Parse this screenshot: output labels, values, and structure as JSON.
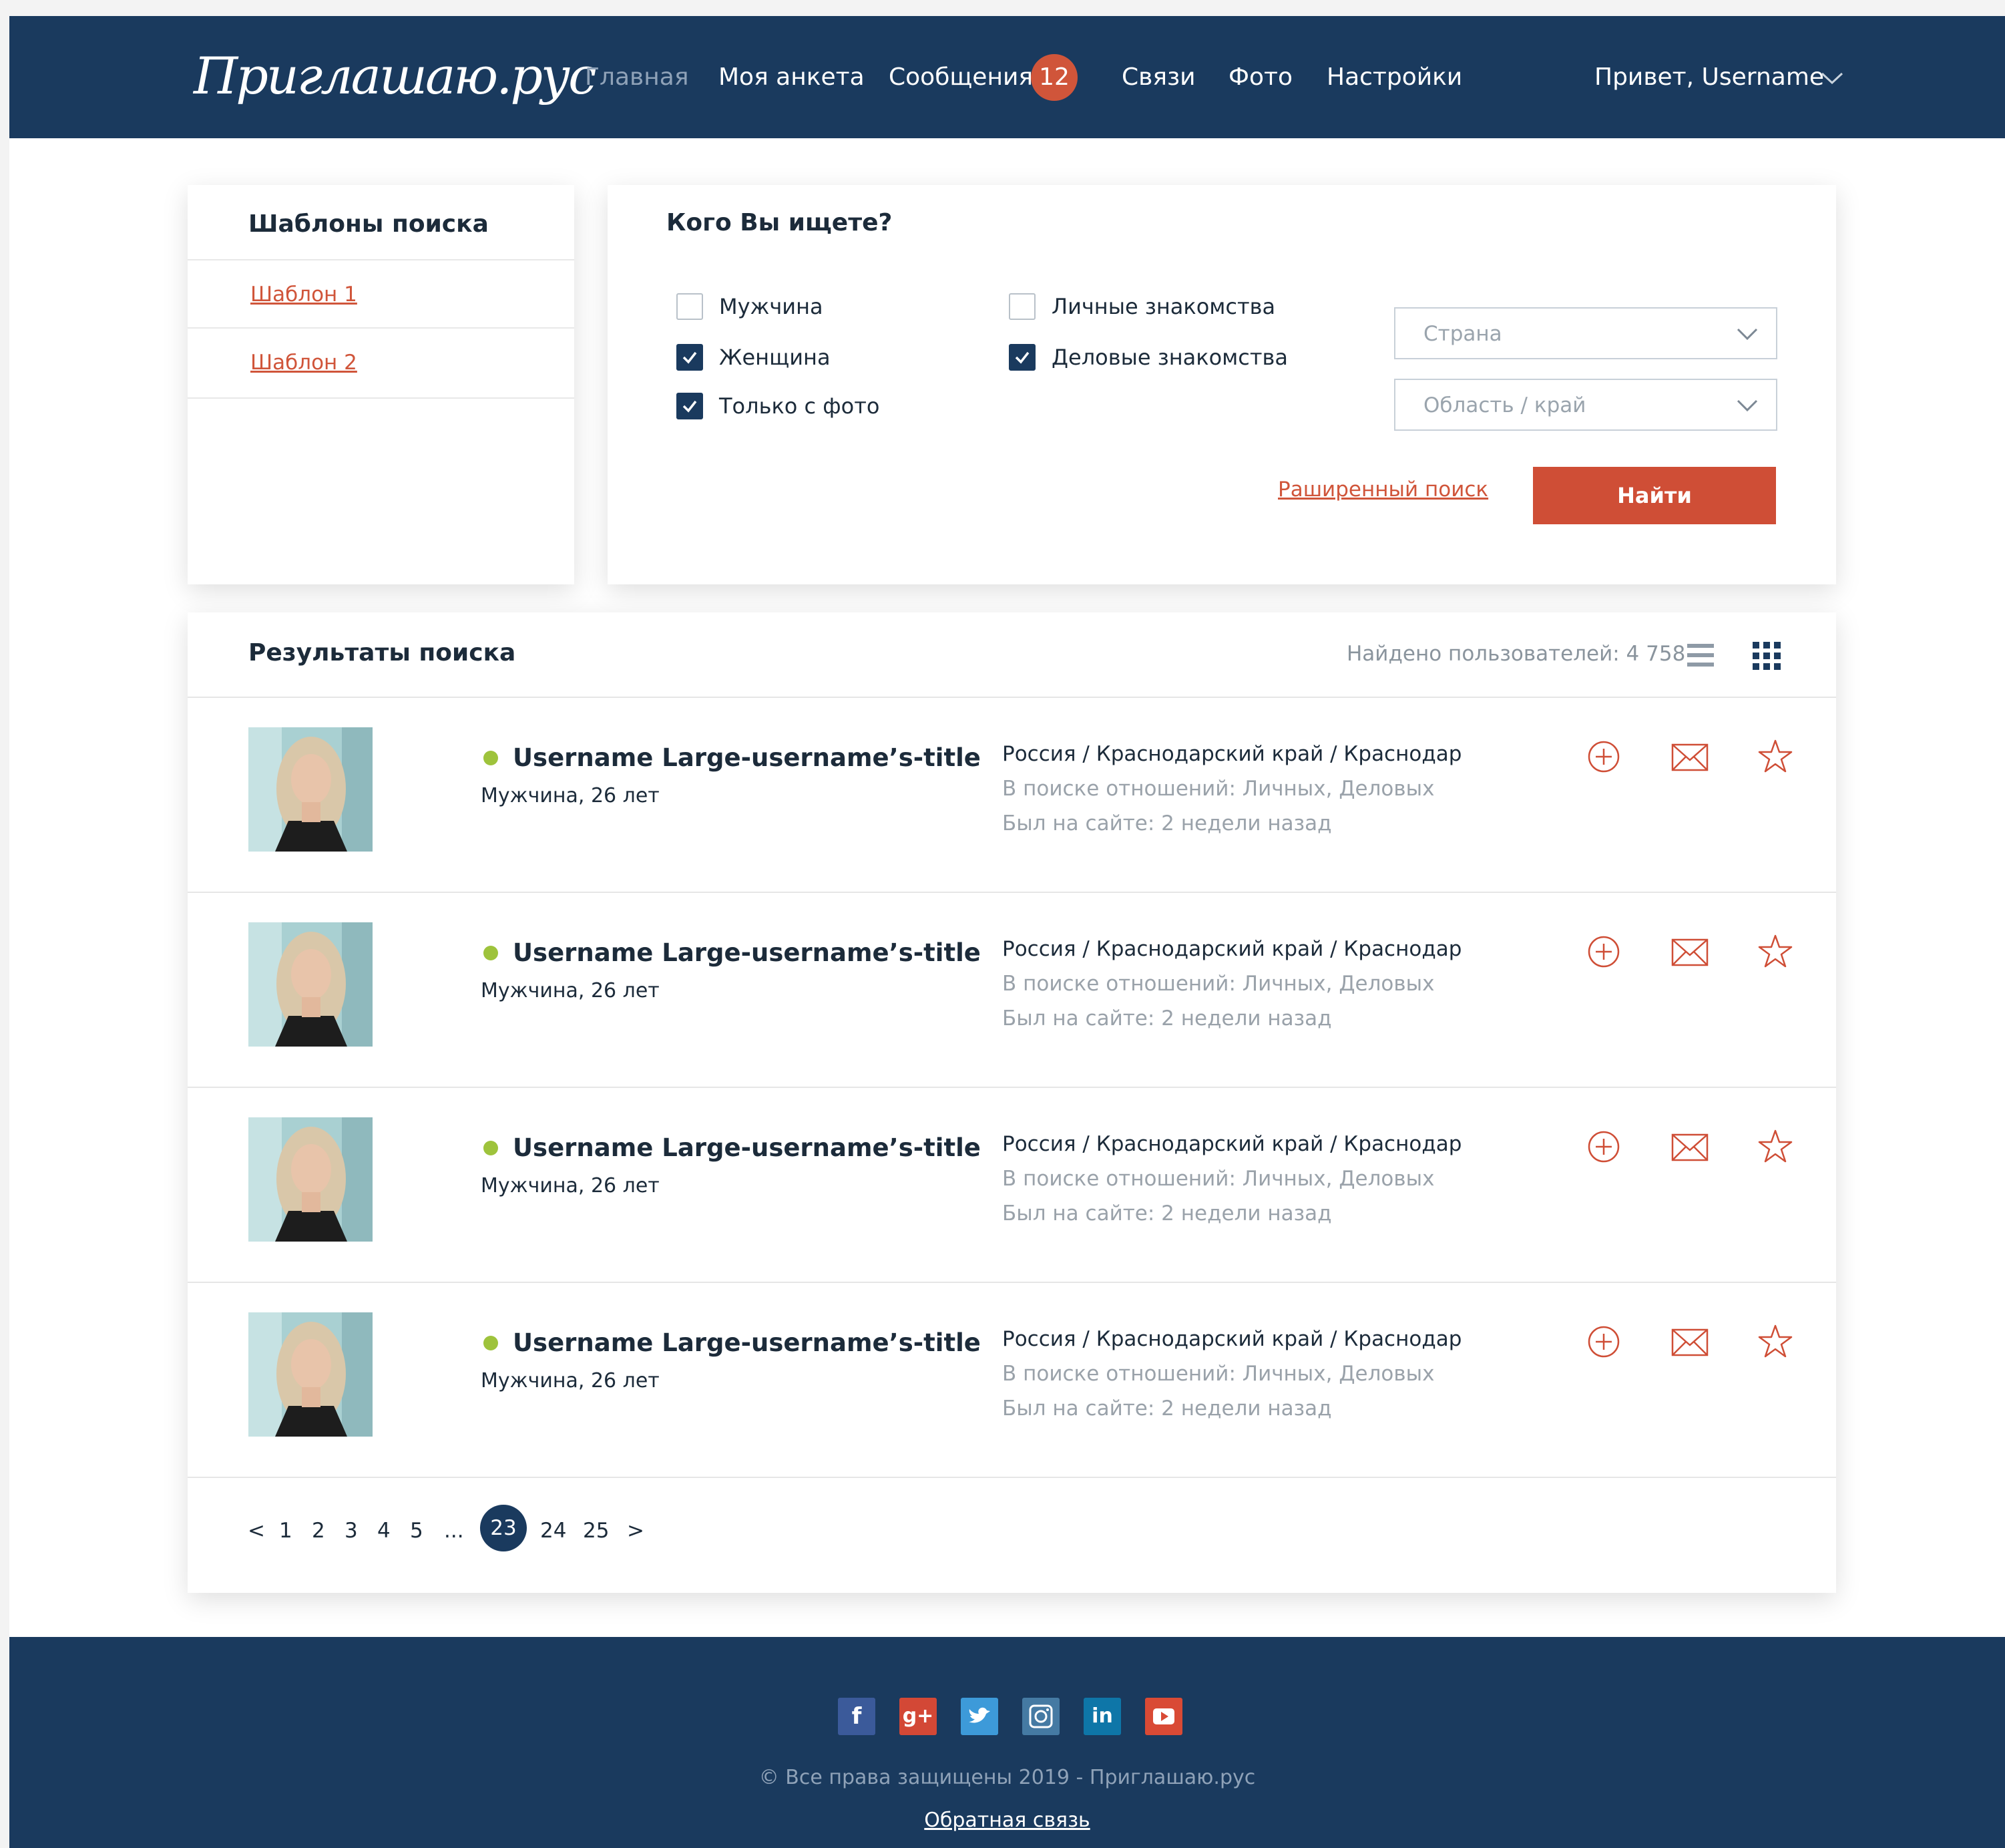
{
  "header": {
    "logo": "Приглашаю.рус",
    "nav": [
      "Главная",
      "Моя анкета",
      "Сообщения",
      "Связи",
      "Фото",
      "Настройки"
    ],
    "messages_badge": "12",
    "greeting": "Привет, Username"
  },
  "templates": {
    "title": "Шаблоны поиска",
    "items": [
      "Шаблон 1",
      "Шаблон 2"
    ]
  },
  "search": {
    "title": "Кого Вы ищете?",
    "options": [
      {
        "label": "Мужчина",
        "checked": false
      },
      {
        "label": "Женщина",
        "checked": true
      },
      {
        "label": "Только с фото",
        "checked": true
      },
      {
        "label": "Личные знакомства",
        "checked": false
      },
      {
        "label": "Деловые знакомства",
        "checked": true
      }
    ],
    "country_placeholder": "Страна",
    "region_placeholder": "Область / край",
    "advanced_link": "Раширенный поиск",
    "find_button": "Найти"
  },
  "results": {
    "title": "Результаты поиска",
    "count_text": "Найдено пользователей: 4 758",
    "items": [
      {
        "name": "Username Large-username’s-title",
        "sub": "Мужчина, 26 лет",
        "location": "Россия / Краснодарский край / Краснодар",
        "relations": "В поиске отношений: Личных, Деловых",
        "last_seen": "Был на сайте: 2 недели назад",
        "online": true
      },
      {
        "name": "Username Large-username’s-title",
        "sub": "Мужчина, 26 лет",
        "location": "Россия / Краснодарский край / Краснодар",
        "relations": "В поиске отношений: Личных, Деловых",
        "last_seen": "Был на сайте: 2 недели назад",
        "online": true
      },
      {
        "name": "Username Large-username’s-title",
        "sub": "Мужчина, 26 лет",
        "location": "Россия / Краснодарский край / Краснодар",
        "relations": "В поиске отношений: Личных, Деловых",
        "last_seen": "Был на сайте: 2 недели назад",
        "online": true
      },
      {
        "name": "Username Large-username’s-title",
        "sub": "Мужчина, 26 лет",
        "location": "Россия / Краснодарский край / Краснодар",
        "relations": "В поиске отношений: Личных, Деловых",
        "last_seen": "Был на сайте: 2 недели назад",
        "online": true
      }
    ]
  },
  "pagination": {
    "prev": "<",
    "pages": [
      "1",
      "2",
      "3",
      "4",
      "5",
      "...",
      "23",
      "24",
      "25"
    ],
    "current": "23",
    "next": ">"
  },
  "footer": {
    "social": [
      "facebook-icon",
      "google-plus-icon",
      "twitter-icon",
      "instagram-icon",
      "linkedin-icon",
      "youtube-icon"
    ],
    "copyright": "© Все права защищены 2019 - Приглашаю.рус",
    "feedback": "Обратная связь"
  },
  "colors": {
    "navy": "#1a3a5e",
    "accent": "#cf4e36",
    "online": "#9ec33c",
    "muted": "#9aa2aa"
  }
}
